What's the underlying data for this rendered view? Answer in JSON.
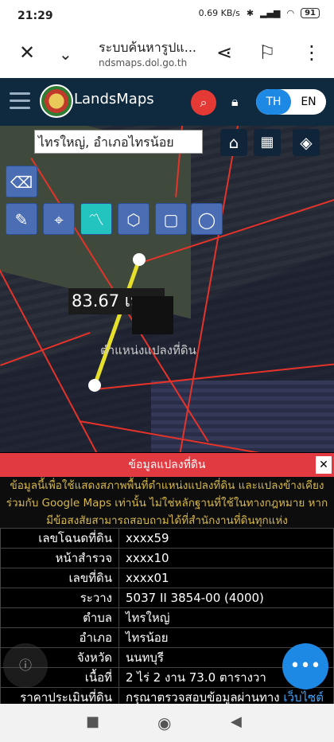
{
  "status": {
    "time": "21:29",
    "net_speed": "0.69 KB/s",
    "battery": "91"
  },
  "browser": {
    "title": "ระบบค้นหารูปแ...",
    "url": "ndsmaps.dol.go.th"
  },
  "app": {
    "brand": "LandsMaps",
    "lang_th": "TH",
    "lang_en": "EN"
  },
  "map": {
    "search_value": "ไทรใหญ่, อำเภอไทรน้อย",
    "measurement": "83.67 เมตร",
    "parcel_label": "ตำแหน่งแปลงที่ดิน"
  },
  "sheet": {
    "title": "ข้อมูลแปลงที่ดิน",
    "notice": "ข้อมูลนี้เพื่อใช้แสดงสภาพพื้นที่ตำแหน่งแปลงที่ดิน และแปลงข้างเคียง ร่วมกับ Google Maps เท่านั้น ไม่ใช่หลักฐานที่ใช้ในทางกฎหมาย หากมีข้อสงสัยสามารถสอบถามได้ที่สำนักงานที่ดินทุกแห่ง",
    "rows": [
      {
        "k": "เลขโฉนดที่ดิน",
        "v": "xxxx59"
      },
      {
        "k": "หน้าสำรวจ",
        "v": "xxxx10"
      },
      {
        "k": "เลขที่ดิน",
        "v": "xxxx01"
      },
      {
        "k": "ระวาง",
        "v": "5037 II 3854-00 (4000)"
      },
      {
        "k": "ตำบล",
        "v": "ไทรใหญ่"
      },
      {
        "k": "อำเภอ",
        "v": "ไทรน้อย"
      },
      {
        "k": "จังหวัด",
        "v": "นนทบุรี"
      },
      {
        "k": "เนื้อที่",
        "v": "2 ไร่ 2 งาน 73.0 ตารางวา"
      }
    ],
    "price_label": "ราคาประเมินที่ดิน",
    "price_value": "กรุณาตรวจสอบข้อมูลผ่านทาง",
    "price_link": "เว็บไซต์"
  }
}
